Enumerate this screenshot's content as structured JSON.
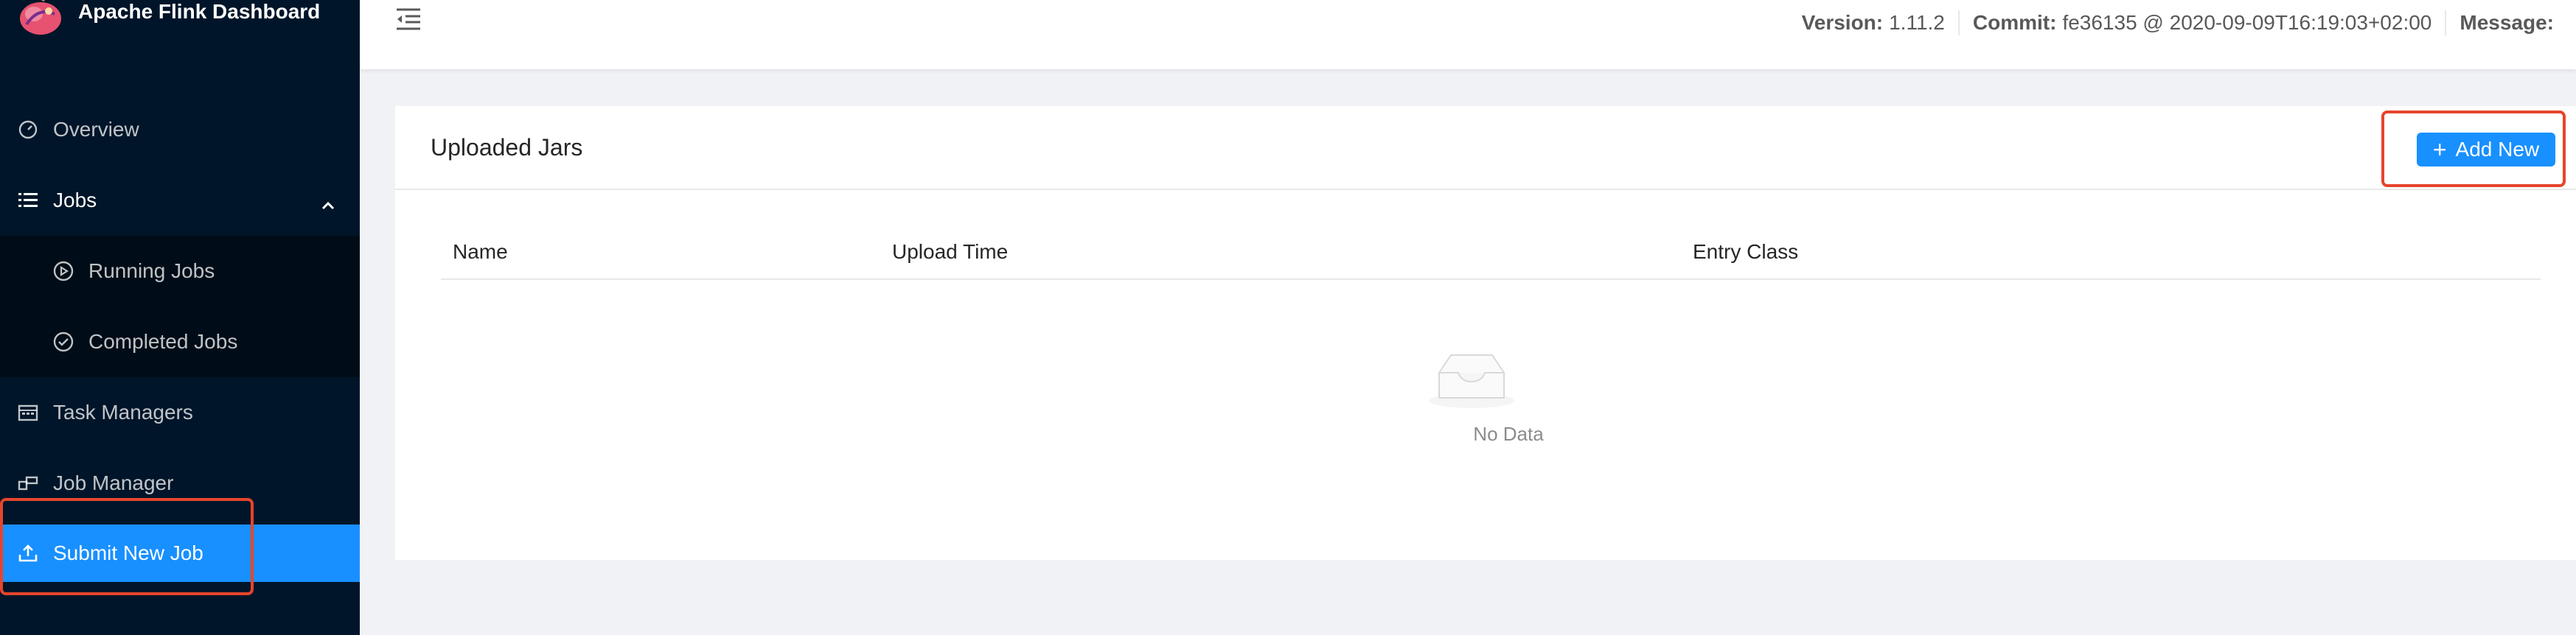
{
  "app": {
    "title": "Apache Flink Dashboard"
  },
  "sidebar": {
    "items": [
      {
        "label": "Overview",
        "icon": "dashboard-icon"
      },
      {
        "label": "Jobs",
        "icon": "list-icon"
      },
      {
        "label": "Running Jobs",
        "icon": "play-circle-icon"
      },
      {
        "label": "Completed Jobs",
        "icon": "check-circle-icon"
      },
      {
        "label": "Task Managers",
        "icon": "schedule-icon"
      },
      {
        "label": "Job Manager",
        "icon": "build-icon"
      },
      {
        "label": "Submit New Job",
        "icon": "upload-icon"
      }
    ]
  },
  "header": {
    "version_label": "Version:",
    "version_value": "1.11.2",
    "commit_label": "Commit:",
    "commit_value": "fe36135 @ 2020-09-09T16:19:03+02:00",
    "message_label": "Message:"
  },
  "main": {
    "card_title": "Uploaded Jars",
    "add_button_label": "Add New",
    "columns": [
      "Name",
      "Upload Time",
      "Entry Class"
    ],
    "empty_text": "No Data"
  },
  "colors": {
    "sidebar_bg": "#001529",
    "submenu_bg": "#000c17",
    "accent": "#1890ff",
    "highlight_border": "#e6452b"
  }
}
